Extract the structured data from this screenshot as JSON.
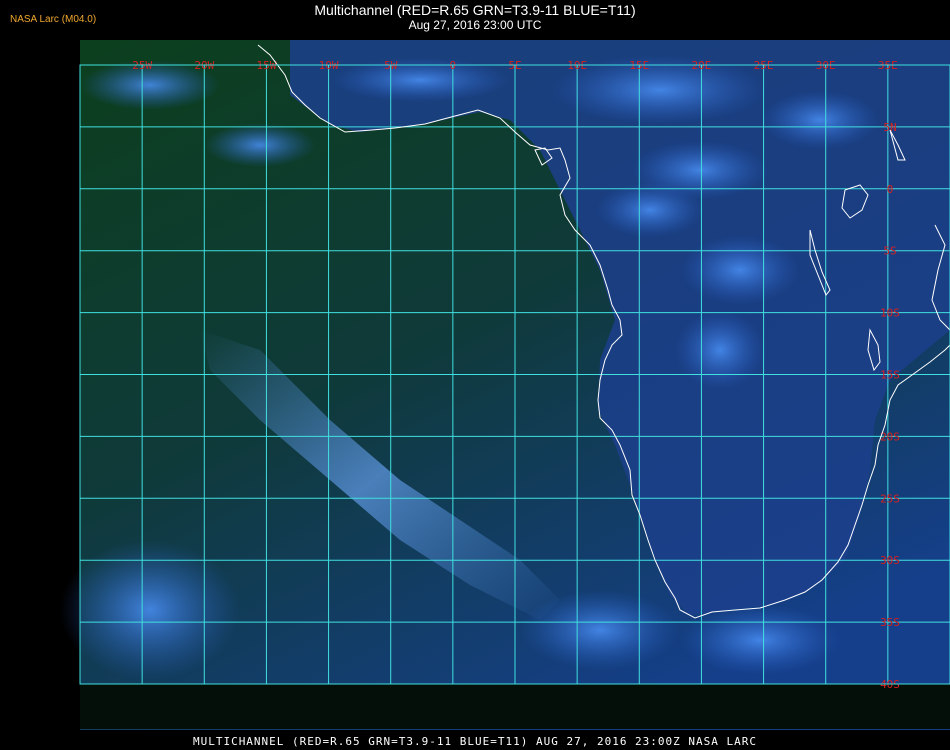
{
  "header": {
    "producer": "NASA Larc (M04.0)",
    "title": "Multichannel (RED=R.65 GRN=T3.9-11 BLUE=T11)",
    "subtitle": "Aug 27, 2016 23:00 UTC"
  },
  "footer": {
    "caption": "MULTICHANNEL (RED=R.65 GRN=T3.9-11 BLUE=T11) AUG 27, 2016 23:00Z   NASA LARC"
  },
  "map": {
    "longitude_labels": [
      "25W",
      "20W",
      "15W",
      "10W",
      "5W",
      "0",
      "5E",
      "10E",
      "15E",
      "20E",
      "25E",
      "30E",
      "35E"
    ],
    "latitude_labels": [
      "5N",
      "0",
      "5S",
      "10S",
      "15S",
      "20S",
      "25S",
      "30S",
      "35S",
      "40S"
    ],
    "colors": {
      "grid": "#40e0e0",
      "label": "#d82020",
      "coastline": "#ffffff",
      "ocean_dark": "#0b3a1c",
      "ocean_blue": "#1a4fb0",
      "cloud": "#3f86f0"
    }
  }
}
